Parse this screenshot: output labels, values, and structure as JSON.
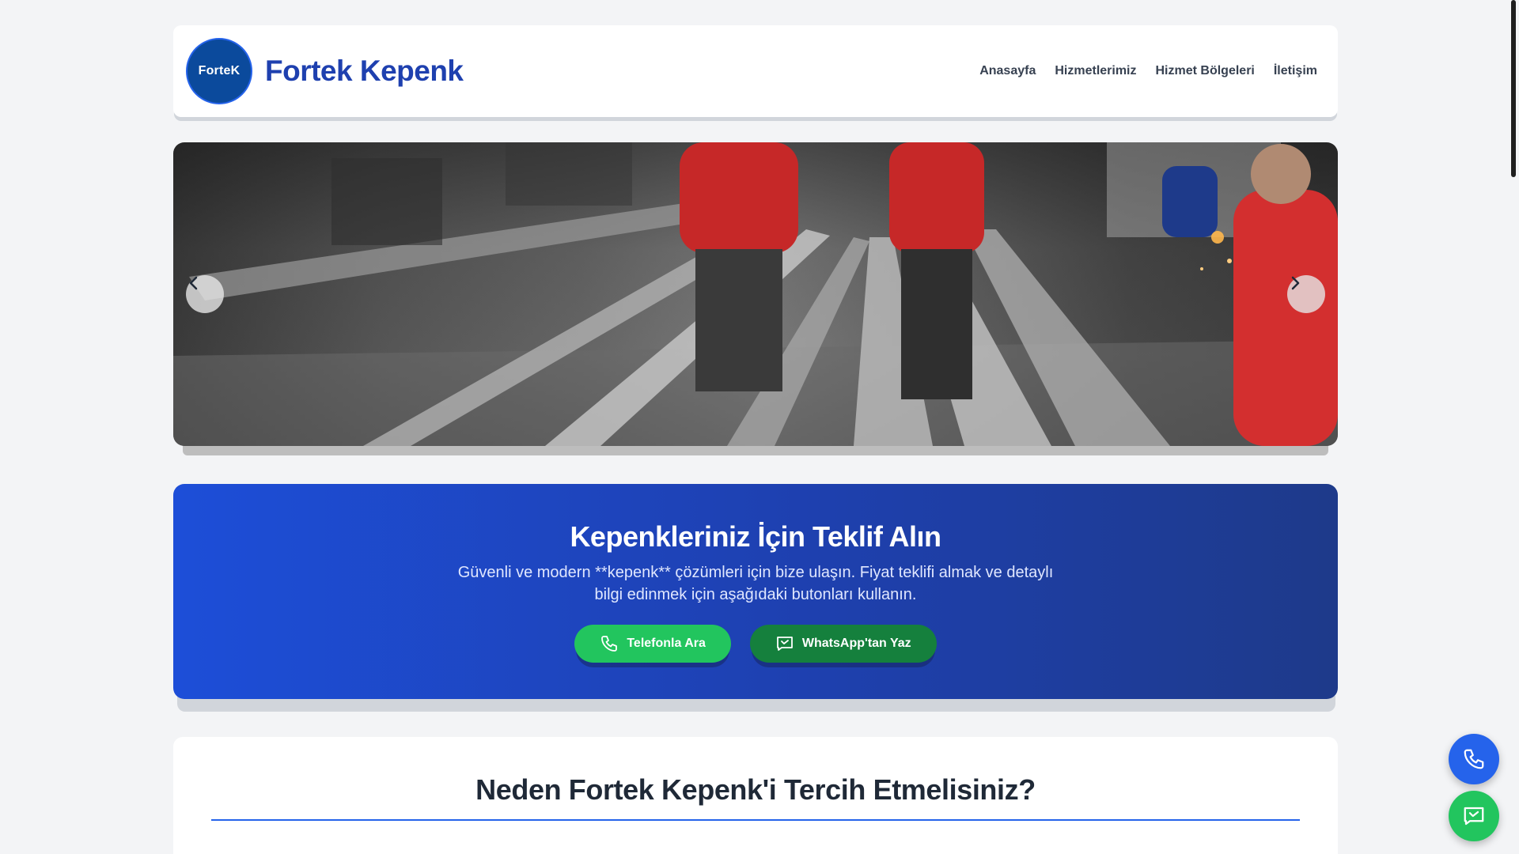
{
  "header": {
    "logo_text": "ForteK",
    "brand_name": "Fortek Kepenk",
    "nav": [
      {
        "label": "Anasayfa"
      },
      {
        "label": "Hizmetlerimiz"
      },
      {
        "label": "Hizmet Bölgeleri"
      },
      {
        "label": "İletişim"
      }
    ]
  },
  "hero": {
    "prev_icon": "chevron-left-icon",
    "next_icon": "chevron-right-icon"
  },
  "cta": {
    "title": "Kepenkleriniz İçin Teklif Alın",
    "description": "Güvenli ve modern **kepenk** çözümleri için bize ulaşın. Fiyat teklifi almak ve detaylı bilgi edinmek için aşağıdaki butonları kullanın.",
    "phone_button": "Telefonla Ara",
    "whatsapp_button": "WhatsApp'tan Yaz"
  },
  "why": {
    "title": "Neden Fortek Kepenk'i Tercih Etmelisiniz?"
  },
  "floating": {
    "call_icon": "phone-icon",
    "whatsapp_icon": "message-icon"
  },
  "colors": {
    "brand": "#1e40af",
    "accent": "#2563eb",
    "green": "#22c55e",
    "dark_green": "#15803d"
  }
}
